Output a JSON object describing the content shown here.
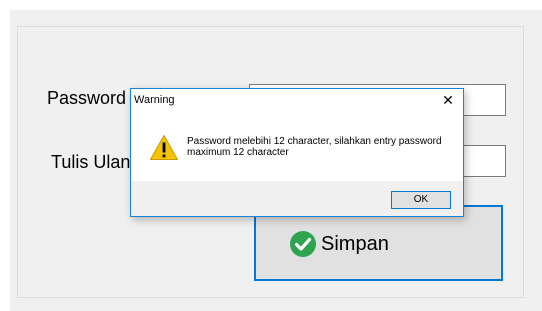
{
  "form": {
    "password_label": "Password",
    "confirm_label": "Tulis Ulan",
    "password_value": "",
    "confirm_value": ""
  },
  "save_button": {
    "label": "Simpan",
    "icon": "check-circle-icon"
  },
  "dialog": {
    "title": "Warning",
    "close_glyph": "✕",
    "message": "Password melebihi 12 character, silahkan entry password maximum 12 character",
    "icon": "warning-icon",
    "ok_label": "OK"
  },
  "colors": {
    "accent": "#0078d7",
    "success": "#2ea44f",
    "warning": "#f5c400"
  }
}
